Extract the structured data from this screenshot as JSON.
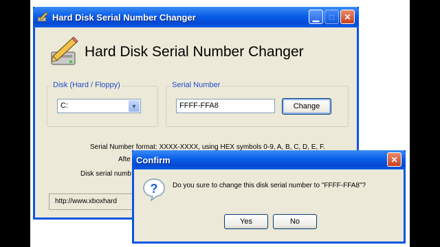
{
  "main_window": {
    "title": "Hard Disk Serial Number Changer",
    "heading": "Hard Disk Serial Number Changer",
    "disk_group_label": "Disk (Hard / Floppy)",
    "disk_selected": "C:",
    "serial_group_label": "Serial Number",
    "serial_value": "FFFF-FFA8",
    "change_button": "Change",
    "info_line_1": "Serial Number format: XXXX-XXXX, using HEX symbols 0-9, A, B, C, D, E, F.",
    "info_line_2": "Afte",
    "info_line_3": "Disk serial numb",
    "url": "http://www.xboxhard"
  },
  "confirm_dialog": {
    "title": "Confirm",
    "message": "Do you sure to change this disk serial number to \"FFFF-FFA8\"?",
    "yes_button": "Yes",
    "no_button": "No"
  },
  "icons": {
    "app_icon": "pencil-disk-icon",
    "question_icon": "question-icon",
    "dropdown_arrow": "chevron-down-icon"
  },
  "colors": {
    "titlebar": "#0a5ee8",
    "window_bg": "#ece9d8",
    "group_label": "#1f49c6"
  }
}
